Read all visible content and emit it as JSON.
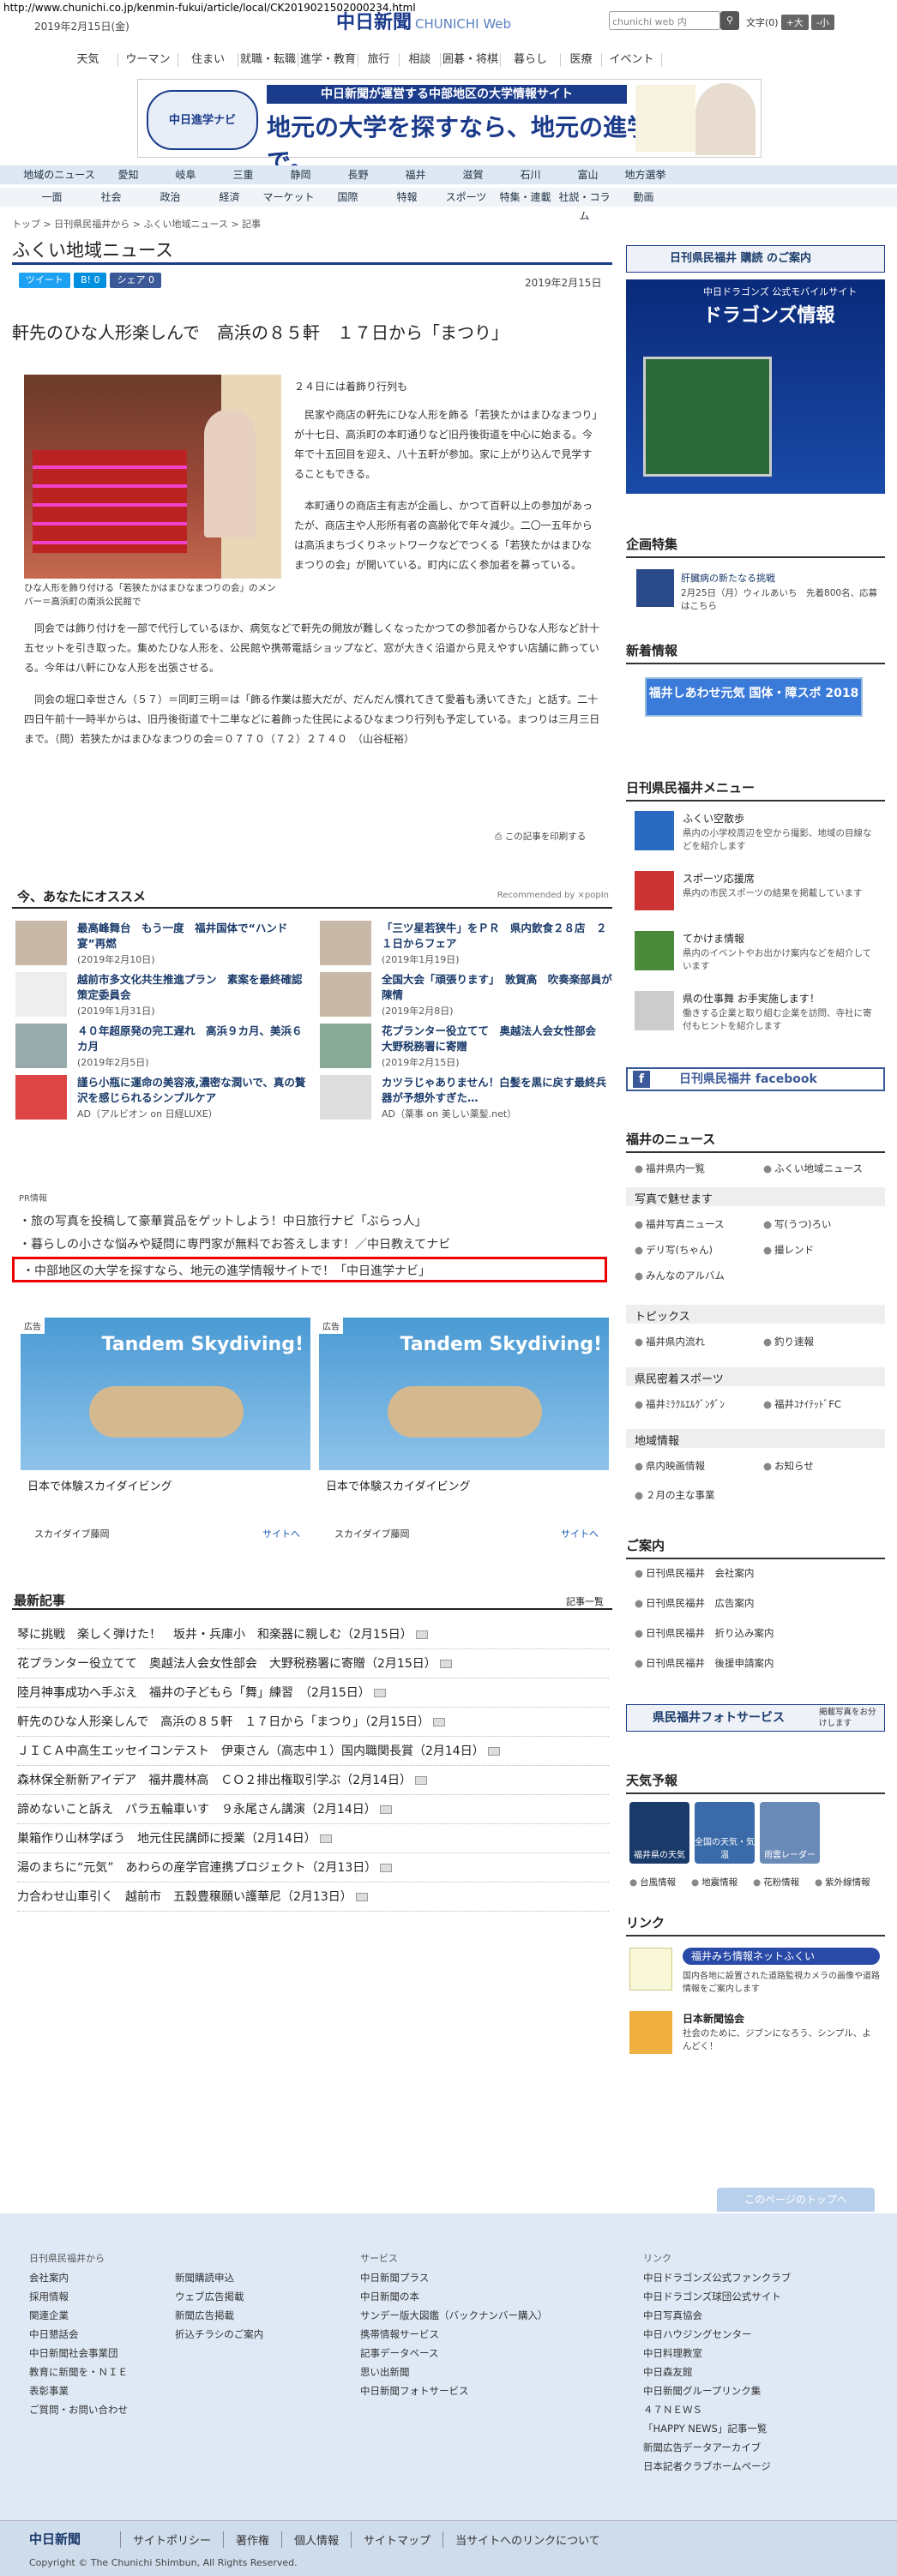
{
  "url": "http://www.chunichi.co.jp/kenmin-fukui/article/local/CK2019021502000234.html",
  "header": {
    "date": "2019年2月15日(金)",
    "logo": "中日新聞",
    "logo_sub": "CHUNICHI Web",
    "search_placeholder": "chunichi web 内",
    "search_icon": "search-icon",
    "font_label": "文字",
    "font_size": "(0)",
    "font_big": "+大",
    "font_small": "-小"
  },
  "gnav": [
    "天気",
    "ウーマン",
    "住まい",
    "就職・転職",
    "進学・教育",
    "旅行",
    "相談",
    "囲碁・将棋",
    "暮らし",
    "医療",
    "イベント"
  ],
  "banner": {
    "logo": "中日進学ナビ",
    "top": "中日新聞が運営する中部地区の大学情報サイト",
    "main": "地元の大学を探すなら、地元の進学サイトで。"
  },
  "rnav": [
    "地域のニュース",
    "愛知",
    "岐阜",
    "三重",
    "静岡",
    "長野",
    "福井",
    "滋賀",
    "石川",
    "富山",
    "地方選挙"
  ],
  "cnav": [
    "一面",
    "社会",
    "政治",
    "経済",
    "マーケット",
    "国際",
    "特報",
    "スポーツ",
    "特集・連載",
    "社説・コラム",
    "動画"
  ],
  "breadcrumb": "トップ > 日刊県民福井から > ふくい地域ニュース > 記事",
  "section": "ふくい地域ニュース",
  "share": {
    "tweet": "ツイート",
    "hatena": "B! 0",
    "fb": "シェア 0"
  },
  "article": {
    "date": "2019年2月15日",
    "title": "軒先のひな人形楽しんで　高浜の８５軒　１７日から「まつり」",
    "caption": "ひな人形を飾り付ける「若狭たかはまひなまつりの会」のメンバー＝高浜町の南浜公民館で",
    "p1": "２４日には着飾り行列も",
    "p2": "　民家や商店の軒先にひな人形を飾る「若狭たかはまひなまつり」が十七日、高浜町の本町通りなど旧丹後街道を中心に始まる。今年で十五回目を迎え、八十五軒が参加。家に上がり込んで見学することもできる。",
    "p3": "　本町通りの商店主有志が企画し、かつて百軒以上の参加があったが、商店主や人形所有者の高齢化で年々減少。二〇一五年からは高浜まちづくりネットワークなどでつくる「若狭たかはまひなまつりの会」が開いている。町内に広く参加者を募っている。",
    "p4": "　同会では飾り付けを一部で代行しているほか、病気などで軒先の開放が難しくなったかつての参加者からひな人形など計十五セットを引き取った。集めたひな人形を、公民館や携帯電話ショップなど、窓が大きく沿道から見えやすい店舗に飾っている。今年は八軒にひな人形を出張させる。",
    "p5": "　同会の堀口幸世さん（５７）＝同町三明＝は「飾る作業は膨大だが、だんだん慣れてきて愛着も湧いてきた」と話す。二十四日午前十一時半からは、旧丹後街道で十二単などに着飾った住民によるひなまつり行列も予定している。まつりは三月三日まで。（問）若狭たかはまひなまつりの会＝０７７０（７２）２７４０　（山谷柾裕）",
    "print": "この記事を印刷する"
  },
  "rec": {
    "heading": "今、あなたにオススメ",
    "popin": "Recommended by ⨯popIn",
    "items": [
      {
        "title": "最高峰舞台　もう一度　福井国体で“ハンド宴”再燃",
        "date": "(2019年2月10日)"
      },
      {
        "title": "「三ツ星若狭牛」をＰＲ　県内飲食２８店　２１日からフェア",
        "date": "(2019年1月19日)"
      },
      {
        "title": "越前市多文化共生推進プラン　素案を最終確認　策定委員会",
        "date": "(2019年1月31日)"
      },
      {
        "title": "全国大会「頑張ります」　敦賀高　吹奏楽部員が陳情",
        "date": "(2019年2月8日)"
      },
      {
        "title": "４０年超原発の完工遅れ　高浜９カ月、美浜６カ月",
        "date": "(2019年2月5日)"
      },
      {
        "title": "花プランター役立てて　奥越法人会女性部会　大野税務署に寄贈",
        "date": "(2019年2月15日)"
      },
      {
        "title": "謹ら小瓶に運命の美容液,濃密な潤いで、真の贅沢を感じられるシンプルケア",
        "date": "AD（アルビオン on 日経LUXE）"
      },
      {
        "title": "カツラじゃありません！白髪を黒に戻す最終兵器が予想外すぎた…",
        "date": "AD（薬事 on 美しい薬髪.net）"
      }
    ]
  },
  "pr": {
    "label": "PR情報",
    "l1": "・旅の写真を投稿して豪華賞品をゲットしよう！中日旅行ナビ「ぶらっ人」",
    "l2": "・暮らしの小さな悩みや疑問に専門家が無料でお答えします！／中日教えてナビ",
    "l3": "・中部地区の大学を探すなら、地元の進学情報サイトで！「中日進学ナビ」"
  },
  "ads": [
    {
      "label": "広告",
      "big": "Tandem Skydiving!",
      "title": "日本で体験スカイダイビング",
      "src": "スカイダイブ藤岡",
      "go": "サイトへ"
    },
    {
      "label": "広告",
      "big": "Tandem Skydiving!",
      "title": "日本で体験スカイダイビング",
      "src": "スカイダイブ藤岡",
      "go": "サイトへ"
    }
  ],
  "latest": {
    "heading": "最新記事",
    "more": "記事一覧",
    "items": [
      "琴に挑戦　楽しく弾けた！　坂井・兵庫小　和楽器に親しむ（2月15日）",
      "花プランター役立てて　奥越法人会女性部会　大野税務署に寄贈（2月15日）",
      "陸月神事成功へ手ぶえ　福井の子どもら「舞」練習　（2月15日）",
      "軒先のひな人形楽しんで　高浜の８５軒　１７日から「まつり」（2月15日）",
      "ＪＩＣＡ中高生エッセイコンテスト　伊東さん（高志中１）国内職関長賞（2月14日）",
      "森林保全新新アイデア　福井農林高　ＣＯ２排出権取引学ぶ（2月14日）",
      "諦めないこと訴え　パラ五輪車いす　９永尾さん講演（2月14日）",
      "巣箱作り山林学ぼう　地元住民講師に授業（2月14日）",
      "湯のまちに“元気”　あわらの産学官連携プロジェクト（2月13日）",
      "力合わせ山車引く　越前市　五穀豊穣願い護華尼（2月13日）"
    ]
  },
  "side": {
    "kodoku": "日刊県民福井 購読 のご案内",
    "dragons1": "中日ドラゴンズ 公式モバイルサイト",
    "dragons2": "ドラゴンズ情報",
    "kikaku": "企画特集",
    "kikaku_t": "肝臓病の新たなる挑戦",
    "kikaku_d": "2月25日（月）ウィルあいち　先着800名、応募はこちら",
    "shinchaku": "新着情報",
    "shin_b": "福井しあわせ元気 国体・障スポ 2018",
    "menu": "日刊県民福井メニュー",
    "menu_items": [
      {
        "t": "ふくい空散歩",
        "d": "県内の小学校周辺を空から撮影、地域の目線などを紹介します"
      },
      {
        "t": "スポーツ応援席",
        "d": "県内の市民スポーツの結果を掲載しています"
      },
      {
        "t": "てかけま情報",
        "d": "県内のイベントやお出かけ案内などを紹介しています"
      },
      {
        "t": "県の仕事舞 お手実施します！",
        "d": "働きする企業と取り組む企業を訪問、寺社に寄付もヒントを紹介します"
      }
    ],
    "fb": "日刊県民福井 facebook",
    "news": "福井のニュース",
    "news_a": "福井県内一覧",
    "news_b": "ふくい地域ニュース",
    "photo": "写真で魅せます",
    "ph1": "福井写真ニュース",
    "ph2": "写(うつ)ろい",
    "ph3": "デリ写(ちゃん)",
    "ph4": "撮レンド",
    "ph5": "みんなのアルバム",
    "topics": "トピックス",
    "tp1": "福井県内流れ",
    "tp2": "釣り速報",
    "sports": "県民密着スポーツ",
    "sp1": "福井ﾐﾗｸﾙｴﾙｸﾞﾝﾀﾞﾝ",
    "sp2": "福井ﾕﾅｲﾃｯﾄﾞFC",
    "chiiki": "地域情報",
    "ch1": "県内映画情報",
    "ch2": "お知らせ",
    "ch3": "２月の主な事業",
    "annai": "ご案内",
    "an1": "日刊県民福井　会社案内",
    "an2": "日刊県民福井　広告案内",
    "an3": "日刊県民福井　折り込み案内",
    "an4": "日刊県民福井　後援申請案内",
    "photosvc": "県民福井フォトサービス",
    "photosvc2": "掲載写真をお分けします",
    "weather": "天気予報",
    "w1": "福井県の天気",
    "w2": "全国の天気・気温",
    "w3": "雨雲レーダー",
    "wl1": "台風情報",
    "wl2": "地震情報",
    "wl3": "花粉情報",
    "wl4": "紫外線情報",
    "link": "リンク",
    "link_t1": "福井みち情報ネットふくい",
    "link_d1": "国内各地に設置された道路監視カメラの画像や道路情報をご案内します",
    "link_t2": "日本新聞協会",
    "link_d2": "社会のために、ジブンになろう、シンプル、よんどく！"
  },
  "totop": "このページのトップへ",
  "footer": {
    "c1h": "日刊県民福井から",
    "c1": [
      "会社案内",
      "採用情報",
      "関連企業",
      "中日懇話会",
      "中日新聞社会事業団",
      "教育に新聞を・ＮＩＥ",
      "表彰事業",
      "ご質問・お問い合わせ"
    ],
    "c2": [
      "新聞購読申込",
      "ウェブ広告掲載",
      "新聞広告掲載",
      "折込チラシのご案内"
    ],
    "c3h": "サービス",
    "c3": [
      "中日新聞プラス",
      "中日新聞の本",
      "サンデー版大図鑑（バックナンバー購入）",
      "携帯情報サービス",
      "記事データベース",
      "思い出新聞",
      "中日新聞フォトサービス"
    ],
    "c4h": "リンク",
    "c4": [
      "中日ドラゴンズ公式ファンクラブ",
      "中日ドラゴンズ球団公式サイト",
      "中日写真協会",
      "中日ハウジングセンター",
      "中日料理教室",
      "中日森友館",
      "中日新聞グループリンク集",
      "４７ＮＥＷＳ",
      "「HAPPY NEWS」記事一覧",
      "新聞広告データアーカイブ",
      "日本記者クラブホームページ"
    ],
    "logo": "中日新聞",
    "links": [
      "サイトポリシー",
      "著作権",
      "個人情報",
      "サイトマップ",
      "当サイトへのリンクについて"
    ],
    "copy": "Copyright © The Chunichi Shimbun, All Rights Reserved."
  }
}
